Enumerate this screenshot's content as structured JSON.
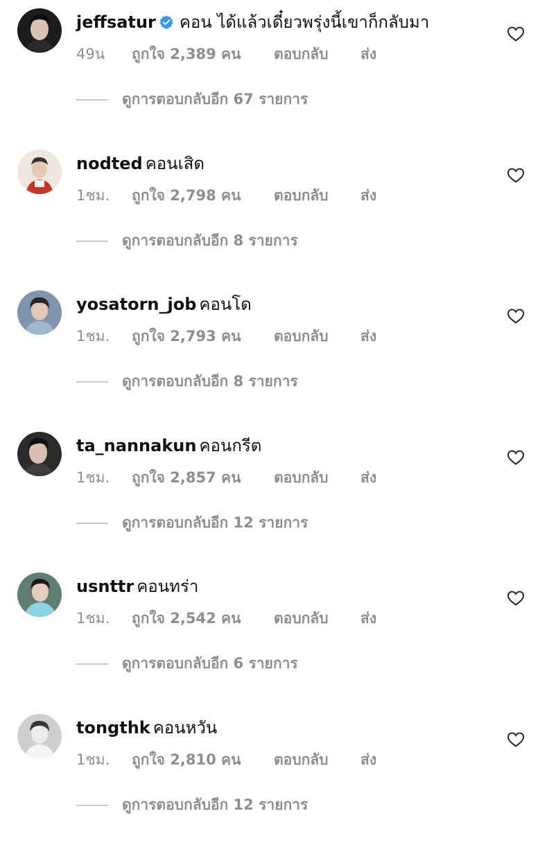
{
  "comments": [
    {
      "username": "jeffsatur",
      "verified": true,
      "text": "คอน ได้แล้วเดี๋ยวพรุ่งนี้เขาก็กลับมา",
      "time": "49น",
      "likes": "ถูกใจ 2,389 คน",
      "reply": "ตอบกลับ",
      "send": "ส่ง",
      "more_replies": "ดูการตอบกลับอีก 67 รายการ"
    },
    {
      "username": "nodted",
      "verified": false,
      "text": "คอนเสิด",
      "time": "1ชม.",
      "likes": "ถูกใจ 2,798 คน",
      "reply": "ตอบกลับ",
      "send": "ส่ง",
      "more_replies": "ดูการตอบกลับอีก 8 รายการ"
    },
    {
      "username": "yosatorn_job",
      "verified": false,
      "text": "คอนโด",
      "time": "1ชม.",
      "likes": "ถูกใจ 2,793 คน",
      "reply": "ตอบกลับ",
      "send": "ส่ง",
      "more_replies": "ดูการตอบกลับอีก 8 รายการ"
    },
    {
      "username": "ta_nannakun",
      "verified": false,
      "text": "คอนกรีต",
      "time": "1ชม.",
      "likes": "ถูกใจ 2,857 คน",
      "reply": "ตอบกลับ",
      "send": "ส่ง",
      "more_replies": "ดูการตอบกลับอีก 12 รายการ"
    },
    {
      "username": "usnttr",
      "verified": false,
      "text": "คอนทร่า",
      "time": "1ชม.",
      "likes": "ถูกใจ 2,542 คน",
      "reply": "ตอบกลับ",
      "send": "ส่ง",
      "more_replies": "ดูการตอบกลับอีก 6 รายการ"
    },
    {
      "username": "tongthk",
      "verified": false,
      "text": "คอนหวัน",
      "time": "1ชม.",
      "likes": "ถูกใจ 2,810 คน",
      "reply": "ตอบกลับ",
      "send": "ส่ง",
      "more_replies": "ดูการตอบกลับอีก 12 รายการ"
    }
  ],
  "colors": {
    "text_primary": "#111111",
    "text_secondary": "#8e8e8e",
    "verified_badge": "#3897f0",
    "divider": "#c7c7c7"
  },
  "icons": {
    "verified": "verified-badge-icon",
    "like": "heart-outline-icon"
  }
}
